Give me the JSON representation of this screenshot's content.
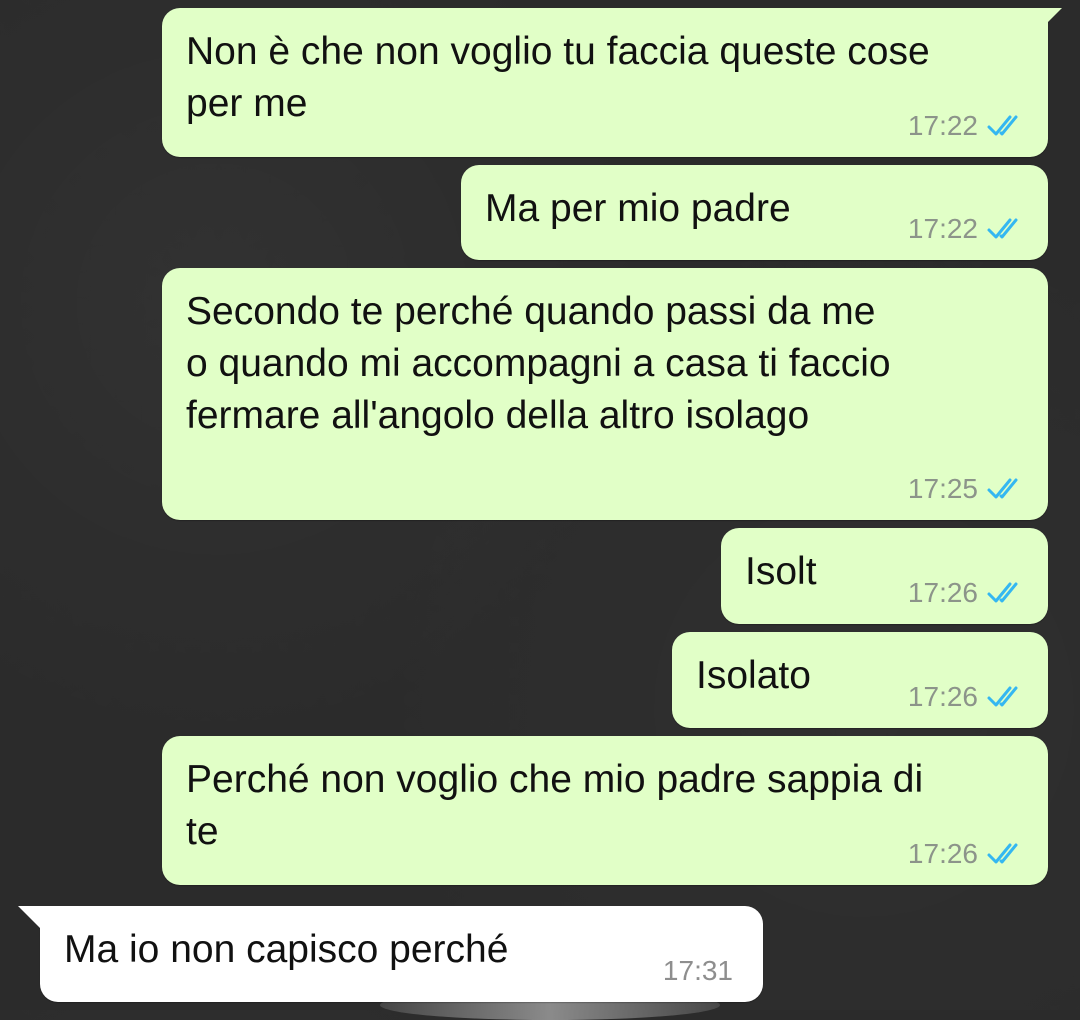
{
  "chat": {
    "messages": [
      {
        "text": "Non è che non voglio tu faccia queste cose\nper me",
        "time": "17:22",
        "direction": "out",
        "status": "read"
      },
      {
        "text": "Ma per mio padre",
        "time": "17:22",
        "direction": "out",
        "status": "read"
      },
      {
        "text": "Secondo te perché quando passi da me\no quando mi accompagni a casa ti faccio\nfermare all'angolo della altro isolago",
        "time": "17:25",
        "direction": "out",
        "status": "read"
      },
      {
        "text": "Isolt",
        "time": "17:26",
        "direction": "out",
        "status": "read"
      },
      {
        "text": "Isolato",
        "time": "17:26",
        "direction": "out",
        "status": "read"
      },
      {
        "text": "Perché non voglio che mio padre sappia di\nte",
        "time": "17:26",
        "direction": "out",
        "status": "read"
      },
      {
        "text": "Ma io non capisco perché",
        "time": "17:31",
        "direction": "in"
      }
    ]
  },
  "colors": {
    "outgoing_bubble": "#e1ffc7",
    "incoming_bubble": "#ffffff",
    "read_ticks": "#34b7f1",
    "wallpaper": "#2b2b2b",
    "timestamp": "#8c948a"
  },
  "icons": {
    "read_receipt": "double-check-icon"
  }
}
